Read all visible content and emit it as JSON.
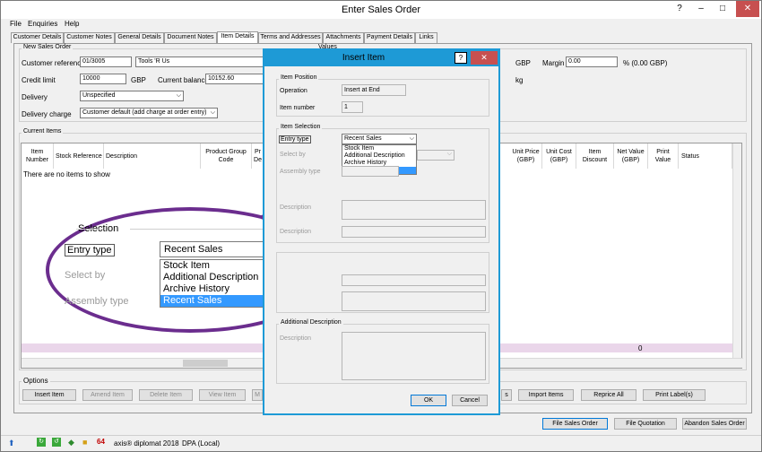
{
  "window": {
    "title": "Enter Sales Order"
  },
  "menu": [
    "File",
    "Enquiries",
    "Help"
  ],
  "tabs": [
    "Customer Details",
    "Customer Notes",
    "General Details",
    "Document Notes",
    "Item Details",
    "Terms and Addresses",
    "Attachments",
    "Payment Details",
    "Links"
  ],
  "order": {
    "group_label": "New Sales Order",
    "values_label": "Values",
    "customer_ref_label": "Customer reference",
    "customer_ref": "01/3005",
    "customer_name": "Tools 'R Us",
    "credit_limit_label": "Credit limit",
    "credit_limit": "10000",
    "currency": "GBP",
    "current_balance_label": "Current balance",
    "current_balance": "10152.60",
    "delivery_label": "Delivery",
    "delivery": "Unspecified",
    "delivery_charge_label": "Delivery charge",
    "delivery_charge": "Customer default (add charge at order entry)",
    "gbp_right": "GBP",
    "margin_label": "Margin",
    "margin_value": "0.00",
    "margin_suffix": "% (0.00 GBP)",
    "kg": "kg"
  },
  "items": {
    "group_label": "Current Items",
    "columns": [
      "Item Number",
      "Stock Reference",
      "Description",
      "Product Group Code",
      "Pr De",
      "Unit Price (GBP)",
      "Unit Cost (GBP)",
      "Item Discount",
      "Net Value (GBP)",
      "Print Value",
      "Status"
    ],
    "empty_text": "There are no items to show",
    "total": "0"
  },
  "options": {
    "label": "Options",
    "buttons": [
      "Insert Item",
      "Amend Item",
      "Delete Item",
      "View Item",
      "M",
      "s",
      "Import Items",
      "Reprice All",
      "Print Label(s)"
    ]
  },
  "footer_buttons": [
    "File Sales Order",
    "File Quotation",
    "Abandon Sales Order"
  ],
  "status": {
    "app": "axis® diplomat 2018",
    "db": "DPA (Local)"
  },
  "dialog": {
    "title": "Insert Item",
    "help": "?",
    "position_label": "Item Position",
    "operation_label": "Operation",
    "operation": "Insert at End",
    "item_number_label": "Item number",
    "item_number": "1",
    "selection_label": "Item Selection",
    "entry_type_label": "Entry type",
    "entry_type": "Recent Sales",
    "select_by_label": "Select by",
    "assembly_type_label": "Assembly type",
    "description_label": "Description",
    "description2_label": "Description",
    "additional_desc_label": "Additional Description",
    "additional_desc_field": "Description",
    "ok": "OK",
    "cancel": "Cancel",
    "options": [
      "Stock Item",
      "Additional Description",
      "Archive History",
      "Recent Sales"
    ]
  },
  "callout": {
    "heading": "Selection",
    "entry_type_label": "Entry type",
    "entry_type": "Recent Sales",
    "select_by_label": "Select by",
    "assembly_type_label": "Assembly type",
    "options": [
      "Stock Item",
      "Additional Description",
      "Archive History",
      "Recent Sales"
    ]
  }
}
